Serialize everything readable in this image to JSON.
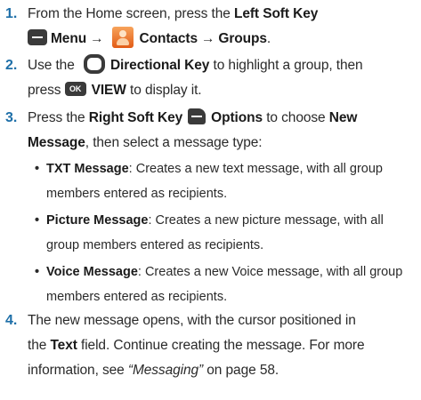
{
  "steps": [
    {
      "number": "1.",
      "line1": {
        "pre": "From the Home screen, press the ",
        "key": "Left Soft Key"
      },
      "line2": {
        "menu": "Menu",
        "arrow1": "→",
        "contacts": "Contacts",
        "arrow2": "→",
        "groups": "Groups",
        "end": "."
      }
    },
    {
      "number": "2.",
      "line1": {
        "pre": "Use the ",
        "key": "Directional Key",
        "post": " to highlight a group, then"
      },
      "line2": {
        "pre": "press ",
        "ok_label": "OK",
        "view": "VIEW",
        "post": " to display it."
      }
    },
    {
      "number": "3.",
      "line1": {
        "pre": "Press the ",
        "key": "Right Soft Key",
        "options": "Options",
        "mid": " to choose ",
        "new": "New"
      },
      "line2": {
        "message": "Message",
        "post": ", then select a message type:"
      },
      "bullets": [
        {
          "dot": "•",
          "title": "TXT Message",
          "line1": ": Creates a new text message, with all group",
          "line2": "members entered as recipients."
        },
        {
          "dot": "•",
          "title": "Picture Message",
          "line1": ": Creates a new picture message, with all",
          "line2": "group members entered as recipients."
        },
        {
          "dot": "•",
          "title": "Voice Message",
          "line1": ": Creates a new Voice message, with all group",
          "line2": "members entered as recipients."
        }
      ]
    },
    {
      "number": "4.",
      "line1": "The new message opens, with the cursor positioned in",
      "line2": {
        "pre": "the ",
        "text_field": "Text",
        "post": " field. Continue creating the message. For more"
      },
      "line3": {
        "pre": "information, see ",
        "ref": "“Messaging”",
        "post": " on page 58."
      }
    }
  ],
  "icons": {
    "left_soft_key": "left-soft-key-icon",
    "contacts": "contacts-icon",
    "directional_key": "directional-key-icon",
    "ok_key": "ok-key-icon",
    "right_soft_key": "right-soft-key-icon"
  },
  "colors": {
    "step_number": "#1e6fa8",
    "contacts_icon": "#e8661f",
    "key_icon": "#3a3a3a"
  }
}
